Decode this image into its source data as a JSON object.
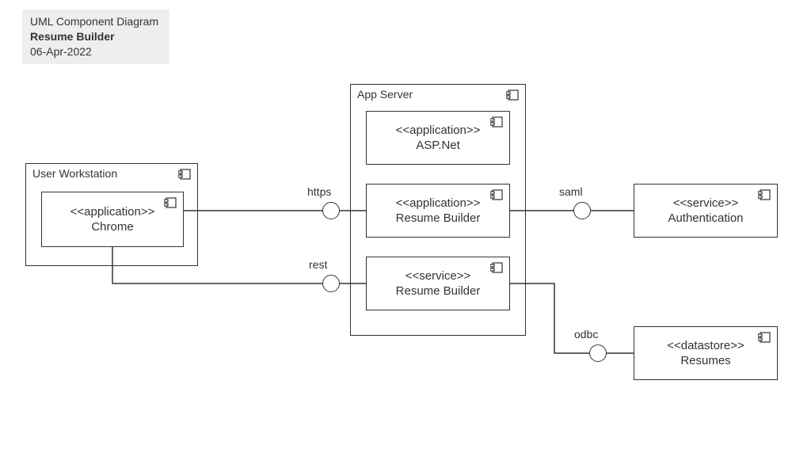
{
  "header": {
    "line1": "UML Component Diagram",
    "line2": "Resume Builder",
    "line3": "06-Apr-2022"
  },
  "containers": {
    "user_workstation": {
      "title": "User Workstation"
    },
    "app_server": {
      "title": "App Server"
    }
  },
  "components": {
    "chrome": {
      "stereotype": "<<application>>",
      "name": "Chrome"
    },
    "aspnet": {
      "stereotype": "<<application>>",
      "name": "ASP.Net"
    },
    "rb_app": {
      "stereotype": "<<application>>",
      "name": "Resume Builder"
    },
    "rb_svc": {
      "stereotype": "<<service>>",
      "name": "Resume Builder"
    },
    "auth": {
      "stereotype": "<<service>>",
      "name": "Authentication"
    },
    "resumes": {
      "stereotype": "<<datastore>>",
      "name": "Resumes"
    }
  },
  "ports": {
    "https": {
      "label": "https"
    },
    "rest": {
      "label": "rest"
    },
    "saml": {
      "label": "saml"
    },
    "odbc": {
      "label": "odbc"
    }
  },
  "chart_data": {
    "type": "diagram",
    "title": "UML Component Diagram — Resume Builder",
    "date": "06-Apr-2022",
    "nodes": [
      {
        "id": "user_workstation",
        "kind": "container",
        "label": "User Workstation"
      },
      {
        "id": "chrome",
        "kind": "component",
        "stereotype": "application",
        "label": "Chrome",
        "parent": "user_workstation"
      },
      {
        "id": "app_server",
        "kind": "container",
        "label": "App Server"
      },
      {
        "id": "aspnet",
        "kind": "component",
        "stereotype": "application",
        "label": "ASP.Net",
        "parent": "app_server"
      },
      {
        "id": "rb_app",
        "kind": "component",
        "stereotype": "application",
        "label": "Resume Builder",
        "parent": "app_server"
      },
      {
        "id": "rb_svc",
        "kind": "component",
        "stereotype": "service",
        "label": "Resume Builder",
        "parent": "app_server"
      },
      {
        "id": "auth",
        "kind": "component",
        "stereotype": "service",
        "label": "Authentication"
      },
      {
        "id": "resumes",
        "kind": "component",
        "stereotype": "datastore",
        "label": "Resumes"
      }
    ],
    "interfaces": [
      {
        "id": "https",
        "label": "https"
      },
      {
        "id": "rest",
        "label": "rest"
      },
      {
        "id": "saml",
        "label": "saml"
      },
      {
        "id": "odbc",
        "label": "odbc"
      }
    ],
    "edges": [
      {
        "from": "chrome",
        "to": "rb_app",
        "via": "https"
      },
      {
        "from": "chrome",
        "to": "rb_svc",
        "via": "rest"
      },
      {
        "from": "rb_app",
        "to": "auth",
        "via": "saml"
      },
      {
        "from": "rb_svc",
        "to": "resumes",
        "via": "odbc"
      }
    ]
  }
}
